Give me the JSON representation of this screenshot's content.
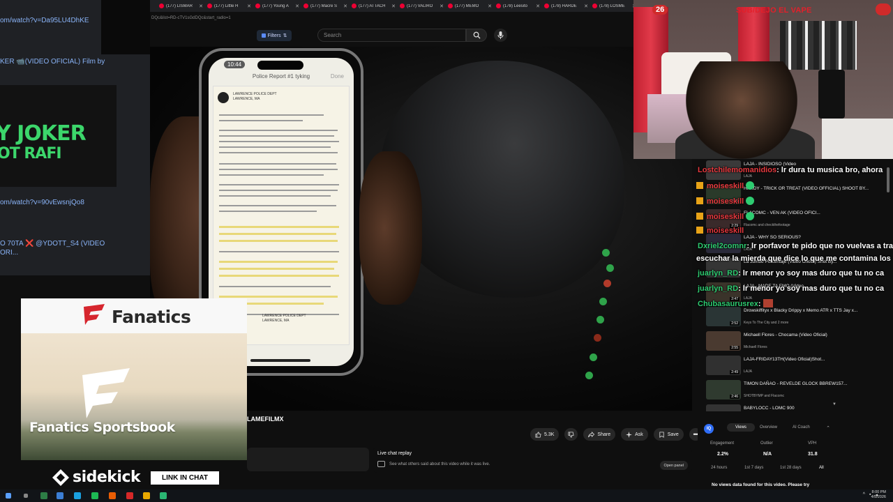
{
  "left_pane": {
    "url_1": "om/watch?v=Da95LU4DhKE",
    "video_title_1": "KER 📹(VIDEO OFICIAL) Film by",
    "thumb_line_1": "Y JOKER",
    "thumb_line_2": "OT RAFI",
    "url_2": "om/watch?v=90vEwsnjQo8",
    "video_title_2": "O 70TA ❌ @YDOTT_S4 (VIDEO ORI..."
  },
  "tabs": [
    {
      "label": "(177) LISMAR"
    },
    {
      "label": "(177) Little H"
    },
    {
      "label": "(177) Young A"
    },
    {
      "label": "(177) Macre S"
    },
    {
      "label": "(177) ATTACH"
    },
    {
      "label": "(177) VALIRO"
    },
    {
      "label": "(177) MEMO"
    },
    {
      "label": "(178) Leesito"
    },
    {
      "label": "(178) HARDE"
    },
    {
      "label": "(178) LOSME"
    }
  ],
  "address_bar": "DQc&list=RD-cTV1sGdDQc&start_radio=1",
  "header": {
    "filters_label": "Filters",
    "search_placeholder": "Search"
  },
  "video": {
    "phone_time": "10:44",
    "phone_title": "Police Report #1 tyking",
    "phone_done": "Done",
    "doc_header": "LAWRENCE POLICE DEPT\nLAWRENCE, MA",
    "doc_footer": "LAWRENCE POLICE DEPT\nLAWRENCE, MA"
  },
  "below_video": {
    "channel_name": "LAMEFILMX",
    "likes": "5.3K",
    "share_label": "Share",
    "ask_label": "Ask",
    "save_label": "Save",
    "live_chat_title": "Live chat replay",
    "live_chat_sub": "See what others said about this video while it was live.",
    "open_panel_label": "Open panel"
  },
  "webcam": {
    "count": "26",
    "title": "SUB/DEJO EL VAPE"
  },
  "up_next": [
    {
      "title": "LAJA - INSIDIOSO (Video",
      "channel": "LAJA",
      "duration": ""
    },
    {
      "title": "HARDY - TRICK OR TREAT (VIDEO OFFICIAL) SHOOT BY...",
      "channel": "",
      "duration": "2:26"
    },
    {
      "title": "FLACOMC - VEN AK (VIDEO OFICI...",
      "channel": "Flacomc and checkthefootage",
      "duration": "2:29"
    },
    {
      "title": "LAJA - WHY SO SERIOUS?",
      "channel": "LAJA",
      "duration": ""
    },
    {
      "title": "La Jumbo Porcentaje (Video Oficial) Shot By...",
      "channel": "",
      "duration": ""
    },
    {
      "title": "LAJA - MADE TA EMO (Video",
      "channel": "LAJA",
      "duration": "2:47"
    },
    {
      "title": "Drowskiffityx x Blacky Drippy x Memo ATR x TTS Jay x...",
      "channel": "Keys To The City and 2 more",
      "duration": "2:52"
    },
    {
      "title": "Michaell Flores - Chocama (Video Oficial)",
      "channel": "Michaell Flores",
      "duration": "2:55"
    },
    {
      "title": "LAJA-FRIDAY13TH(Video Oficial)Shot...",
      "channel": "LAJA",
      "duration": "2:49"
    },
    {
      "title": "TIMON DAÑAO - REVELDE GLOCK BBREW157...",
      "channel": "SHOTBYMP and Flacomc",
      "duration": "2:46"
    },
    {
      "title": "BABYLOCC - LOMC 900",
      "channel": "",
      "duration": ""
    }
  ],
  "chat": [
    {
      "user": "Lostchilemomanidios",
      "msg": ": lr dura tu musica bro, ahora"
    },
    {
      "user": "moiseskill",
      "msg": ""
    },
    {
      "user": "moiseskill",
      "msg": ""
    },
    {
      "user": "moiseskill",
      "msg": ""
    },
    {
      "user": "moiseskill",
      "msg": ""
    },
    {
      "user": "Dxriel2comnr",
      "msg": ": lr porfavor te pido que no vuelvas a tra"
    },
    {
      "user": "",
      "msg": "escuchar la mierda que dice lo que me contamina los"
    },
    {
      "user": "juarlyn_RD",
      "msg": ": lr menor yo soy mas duro que tu no ca"
    },
    {
      "user": "juarlyn_RD",
      "msg": ": lr menor yo soy mas duro que tu no ca"
    },
    {
      "user": "Chubasaurusrex",
      "msg": ":"
    }
  ],
  "analytics": {
    "logo": "IQ",
    "tabs": [
      "Views",
      "Overview",
      "AI Coach"
    ],
    "metrics": [
      {
        "label": "Engagement",
        "value": "2.2%"
      },
      {
        "label": "Outlier",
        "value": "N/A"
      },
      {
        "label": "VPH",
        "value": "31.8"
      }
    ],
    "ranges": [
      "24 hours",
      "1st 7 days",
      "1st 28 days",
      "All"
    ],
    "empty_message": "No views data found for this video. Please try"
  },
  "ad": {
    "brand": "Fanatics",
    "sportsbook": "Fanatics Sportsbook",
    "sidekick": "sidekick",
    "link_chat": "LINK IN CHAT"
  },
  "taskbar": {
    "time": "8:00 PM",
    "date": "4/5/2026"
  },
  "colors": {
    "yt_bg": "#0f0f0f",
    "chat_green": "#2ecc71",
    "chat_red": "#e8393f",
    "accent_red": "#e31f2a",
    "fanatics_red": "#d6262e"
  }
}
